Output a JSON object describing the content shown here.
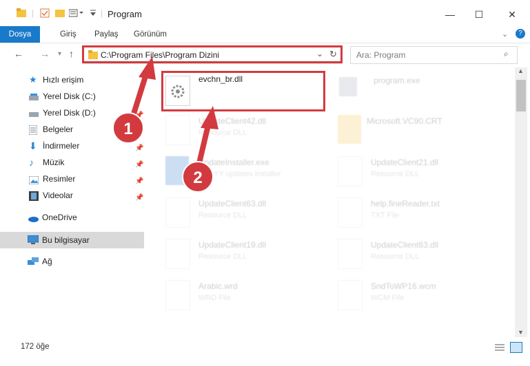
{
  "window": {
    "title": "Program",
    "minimize": "—",
    "maximize": "☐",
    "close": "✕"
  },
  "ribbon": {
    "tabs": [
      "Dosya",
      "Giriş",
      "Paylaş",
      "Görünüm"
    ]
  },
  "nav": {
    "address": "C:\\Program Files\\Program Dizini",
    "search_placeholder": "Ara: Program"
  },
  "sidebar": {
    "items": [
      {
        "label": "Hızlı erişim",
        "icon": "star-icon"
      },
      {
        "label": "Yerel Disk (C:)",
        "icon": "drive-icon"
      },
      {
        "label": "Yerel Disk (D:)",
        "icon": "drive-icon"
      },
      {
        "label": "Belgeler",
        "icon": "documents-icon"
      },
      {
        "label": "İndirmeler",
        "icon": "download-icon"
      },
      {
        "label": "Müzik",
        "icon": "music-icon"
      },
      {
        "label": "Resimler",
        "icon": "pictures-icon"
      },
      {
        "label": "Videolar",
        "icon": "videos-icon"
      },
      {
        "label": "OneDrive",
        "icon": "cloud-icon"
      },
      {
        "label": "Bu bilgisayar",
        "icon": "computer-icon"
      },
      {
        "label": "Ağ",
        "icon": "network-icon"
      }
    ]
  },
  "files": {
    "highlighted": {
      "name": "evchn_br.dll"
    },
    "ghost": [
      {
        "name": "program.exe",
        "type": ""
      },
      {
        "name": "UpdateClient42.dll",
        "type": "Resource DLL"
      },
      {
        "name": "Microsoft.VC90.CRT",
        "type": ""
      },
      {
        "name": "UpdateInstaller.exe",
        "type": "ABBYY updates installer"
      },
      {
        "name": "UpdateClient21.dll",
        "type": "Resource DLL"
      },
      {
        "name": "UpdateClient63.dll",
        "type": "Resource DLL"
      },
      {
        "name": "help.fineReader.txt",
        "type": "TXT File"
      },
      {
        "name": "UpdateClient19.dll",
        "type": "Resource DLL"
      },
      {
        "name": "UpdateClient63.dll",
        "type": "Resource DLL"
      },
      {
        "name": "Arabic.wrd",
        "type": "WRD File"
      },
      {
        "name": "SndToWP16.wcm",
        "type": "WCM File"
      }
    ]
  },
  "status": {
    "count": "172 öğe"
  },
  "callouts": [
    "1",
    "2"
  ],
  "colors": {
    "accent": "#1979ca",
    "highlight": "#d23a3f",
    "folder": "#f5c342"
  }
}
